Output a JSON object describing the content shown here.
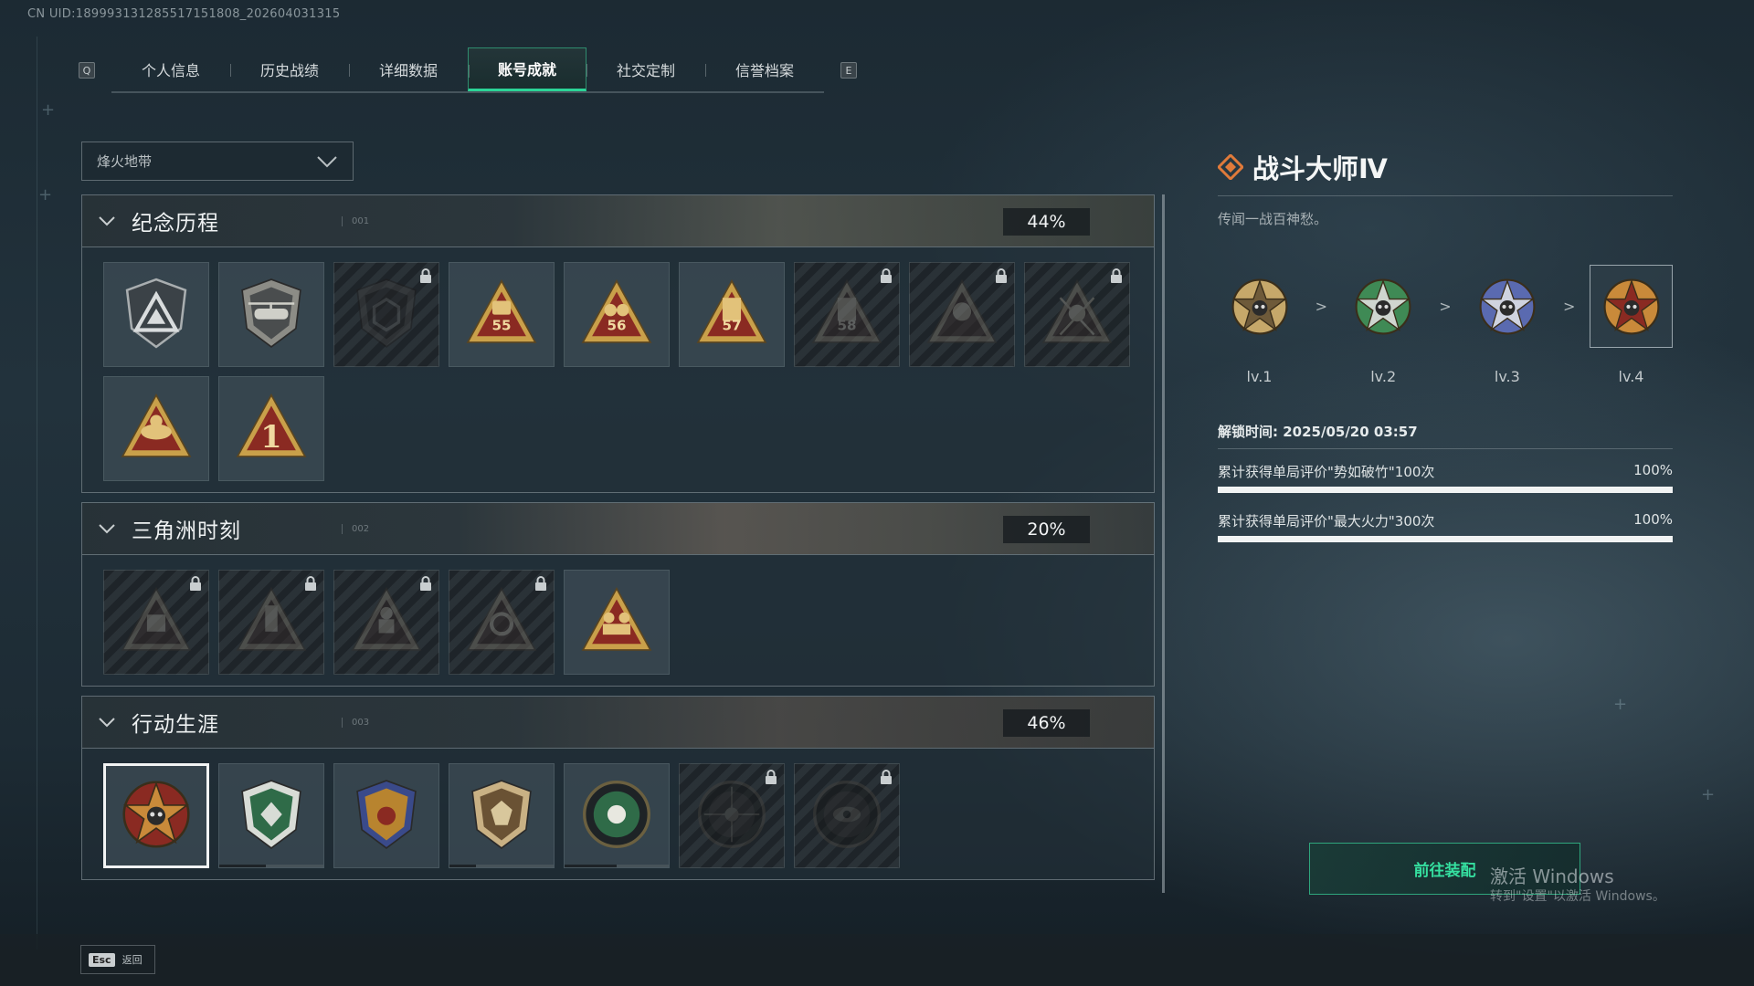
{
  "uid_text": "CN UID:1899931312855171518​08_202604031315",
  "tabs": {
    "left_key": "Q",
    "right_key": "E",
    "items": [
      "个人信息",
      "历史战绩",
      "详细数据",
      "账号成就",
      "社交定制",
      "信誉档案"
    ],
    "active_index": 3
  },
  "filter": {
    "selected": "烽火地带"
  },
  "sections": [
    {
      "title": "纪念历程",
      "num": "001",
      "percent": "44%",
      "badges": [
        {
          "icon": "triangle-emblem-icon",
          "locked": false
        },
        {
          "icon": "helicopter-emblem-icon",
          "locked": false
        },
        {
          "icon": "hex-shield-emblem-icon",
          "locked": true
        },
        {
          "icon": "season-55-emblem-icon",
          "locked": false,
          "text": "55"
        },
        {
          "icon": "season-56-emblem-icon",
          "locked": false,
          "text": "56"
        },
        {
          "icon": "season-57-emblem-icon",
          "locked": false,
          "text": "57"
        },
        {
          "icon": "season-58-emblem-icon",
          "locked": true,
          "text": "58"
        },
        {
          "icon": "masked-figure-emblem-icon",
          "locked": true
        },
        {
          "icon": "skull-crossed-emblem-icon",
          "locked": true
        },
        {
          "icon": "wreath-emblem-icon",
          "locked": false
        },
        {
          "icon": "number-one-emblem-icon",
          "locked": false,
          "text": "1"
        }
      ]
    },
    {
      "title": "三角洲时刻",
      "num": "002",
      "percent": "20%",
      "badges": [
        {
          "icon": "crate-emblem-icon",
          "locked": true
        },
        {
          "icon": "totem-emblem-icon",
          "locked": true
        },
        {
          "icon": "soldier-emblem-icon",
          "locked": true
        },
        {
          "icon": "circle-knot-emblem-icon",
          "locked": true
        },
        {
          "icon": "squad-emblem-icon",
          "locked": false
        }
      ]
    },
    {
      "title": "行动生涯",
      "num": "003",
      "percent": "46%",
      "badges": [
        {
          "icon": "star-skull-medal-icon",
          "locked": false,
          "selected": true
        },
        {
          "icon": "green-shield-medal-icon",
          "locked": false,
          "progress": 0.45
        },
        {
          "icon": "laurel-crest-medal-icon",
          "locked": false
        },
        {
          "icon": "gem-shield-medal-icon",
          "locked": false,
          "progress": 0.25
        },
        {
          "icon": "green-orb-medal-icon",
          "locked": false,
          "progress": 0.5
        },
        {
          "icon": "crosshair-skull-medal-icon",
          "locked": true
        },
        {
          "icon": "eye-medal-icon",
          "locked": true
        }
      ]
    }
  ],
  "detail": {
    "title": "战斗大师Ⅳ",
    "description": "传闻一战百神愁。",
    "levels": [
      "lv.1",
      "lv.2",
      "lv.3",
      "lv.4"
    ],
    "current_level_index": 3,
    "arrow": ">",
    "unlock_time": "解锁时间: 2025/05/20 03:57",
    "conditions": [
      {
        "text": "累计获得单局评价\"势如破竹\"100次",
        "percent": "100%",
        "progress": 1.0
      },
      {
        "text": "累计获得单局评价\"最大火力\"300次",
        "percent": "100%",
        "progress": 1.0
      }
    ]
  },
  "equip_button": "前往装配",
  "windows_watermark": {
    "line1": "激活 Windows",
    "line2": "转到\"设置\"以激活 Windows。"
  },
  "esc": {
    "key": "Esc",
    "label": "返回"
  },
  "colors": {
    "accent_green": "#2bd497",
    "gold": "#c9a04a",
    "dark_red": "#8a2a22"
  }
}
